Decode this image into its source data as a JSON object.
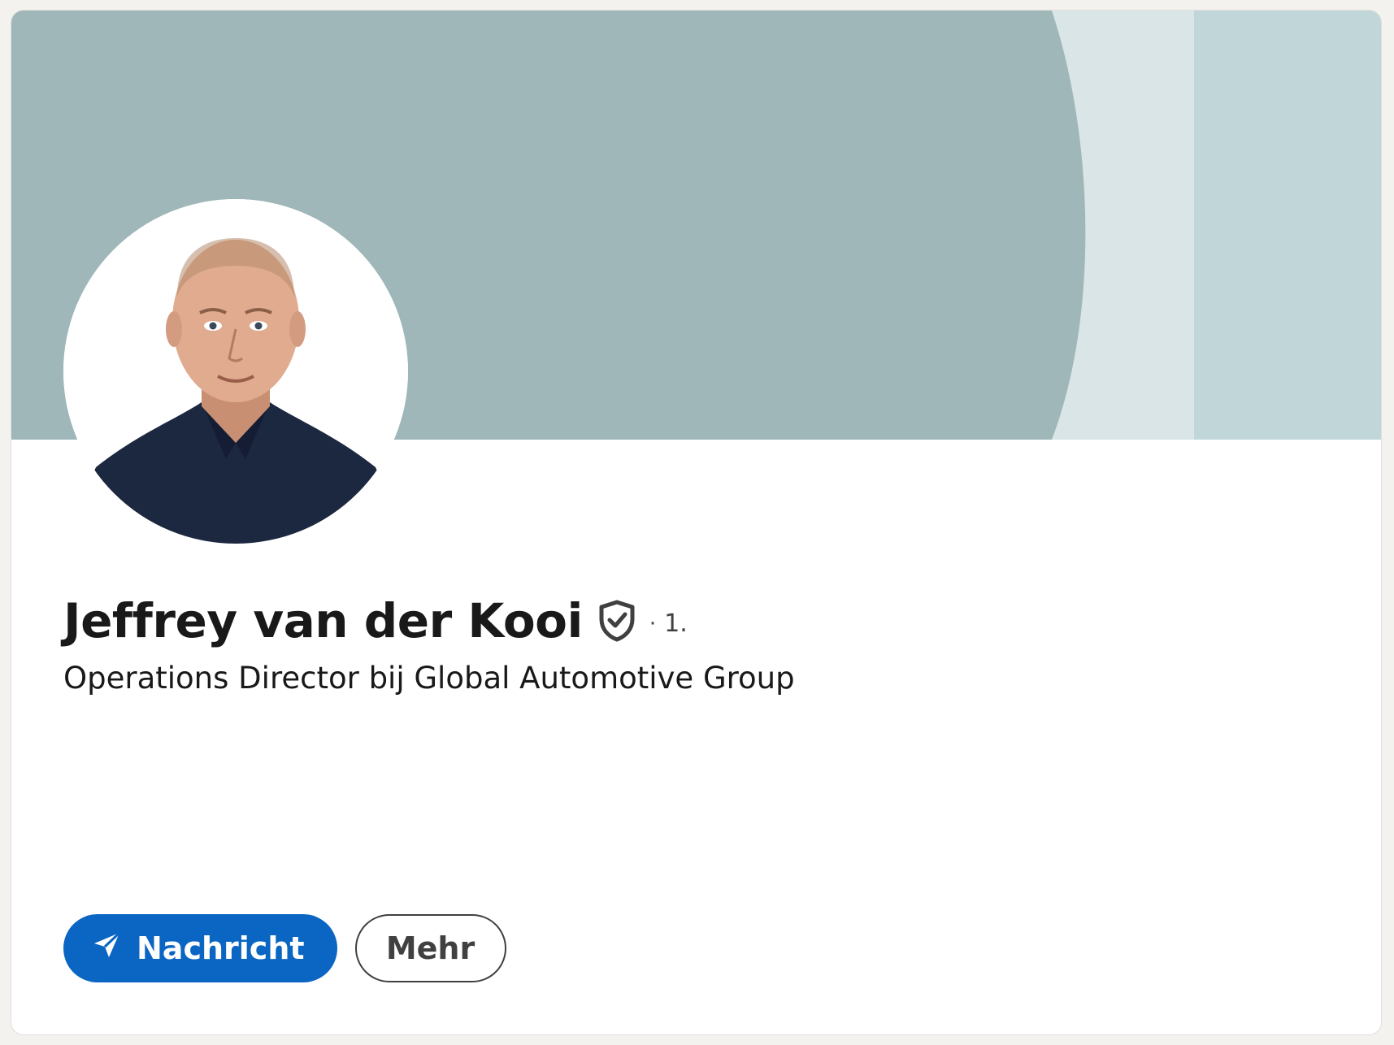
{
  "profile": {
    "name": "Jeffrey van der Kooi",
    "connection_degree": "1.",
    "degree_separator": "·",
    "headline": "Operations Director bij Global Automotive Group"
  },
  "actions": {
    "message_label": "Nachricht",
    "more_label": "Mehr"
  },
  "icons": {
    "verified": "shield-check-icon",
    "message": "send-icon"
  },
  "colors": {
    "primary_button": "#0a66c2",
    "banner_main": "#9fb7b8",
    "banner_light": "#d9e5e6",
    "banner_right": "#c1d6d8"
  }
}
